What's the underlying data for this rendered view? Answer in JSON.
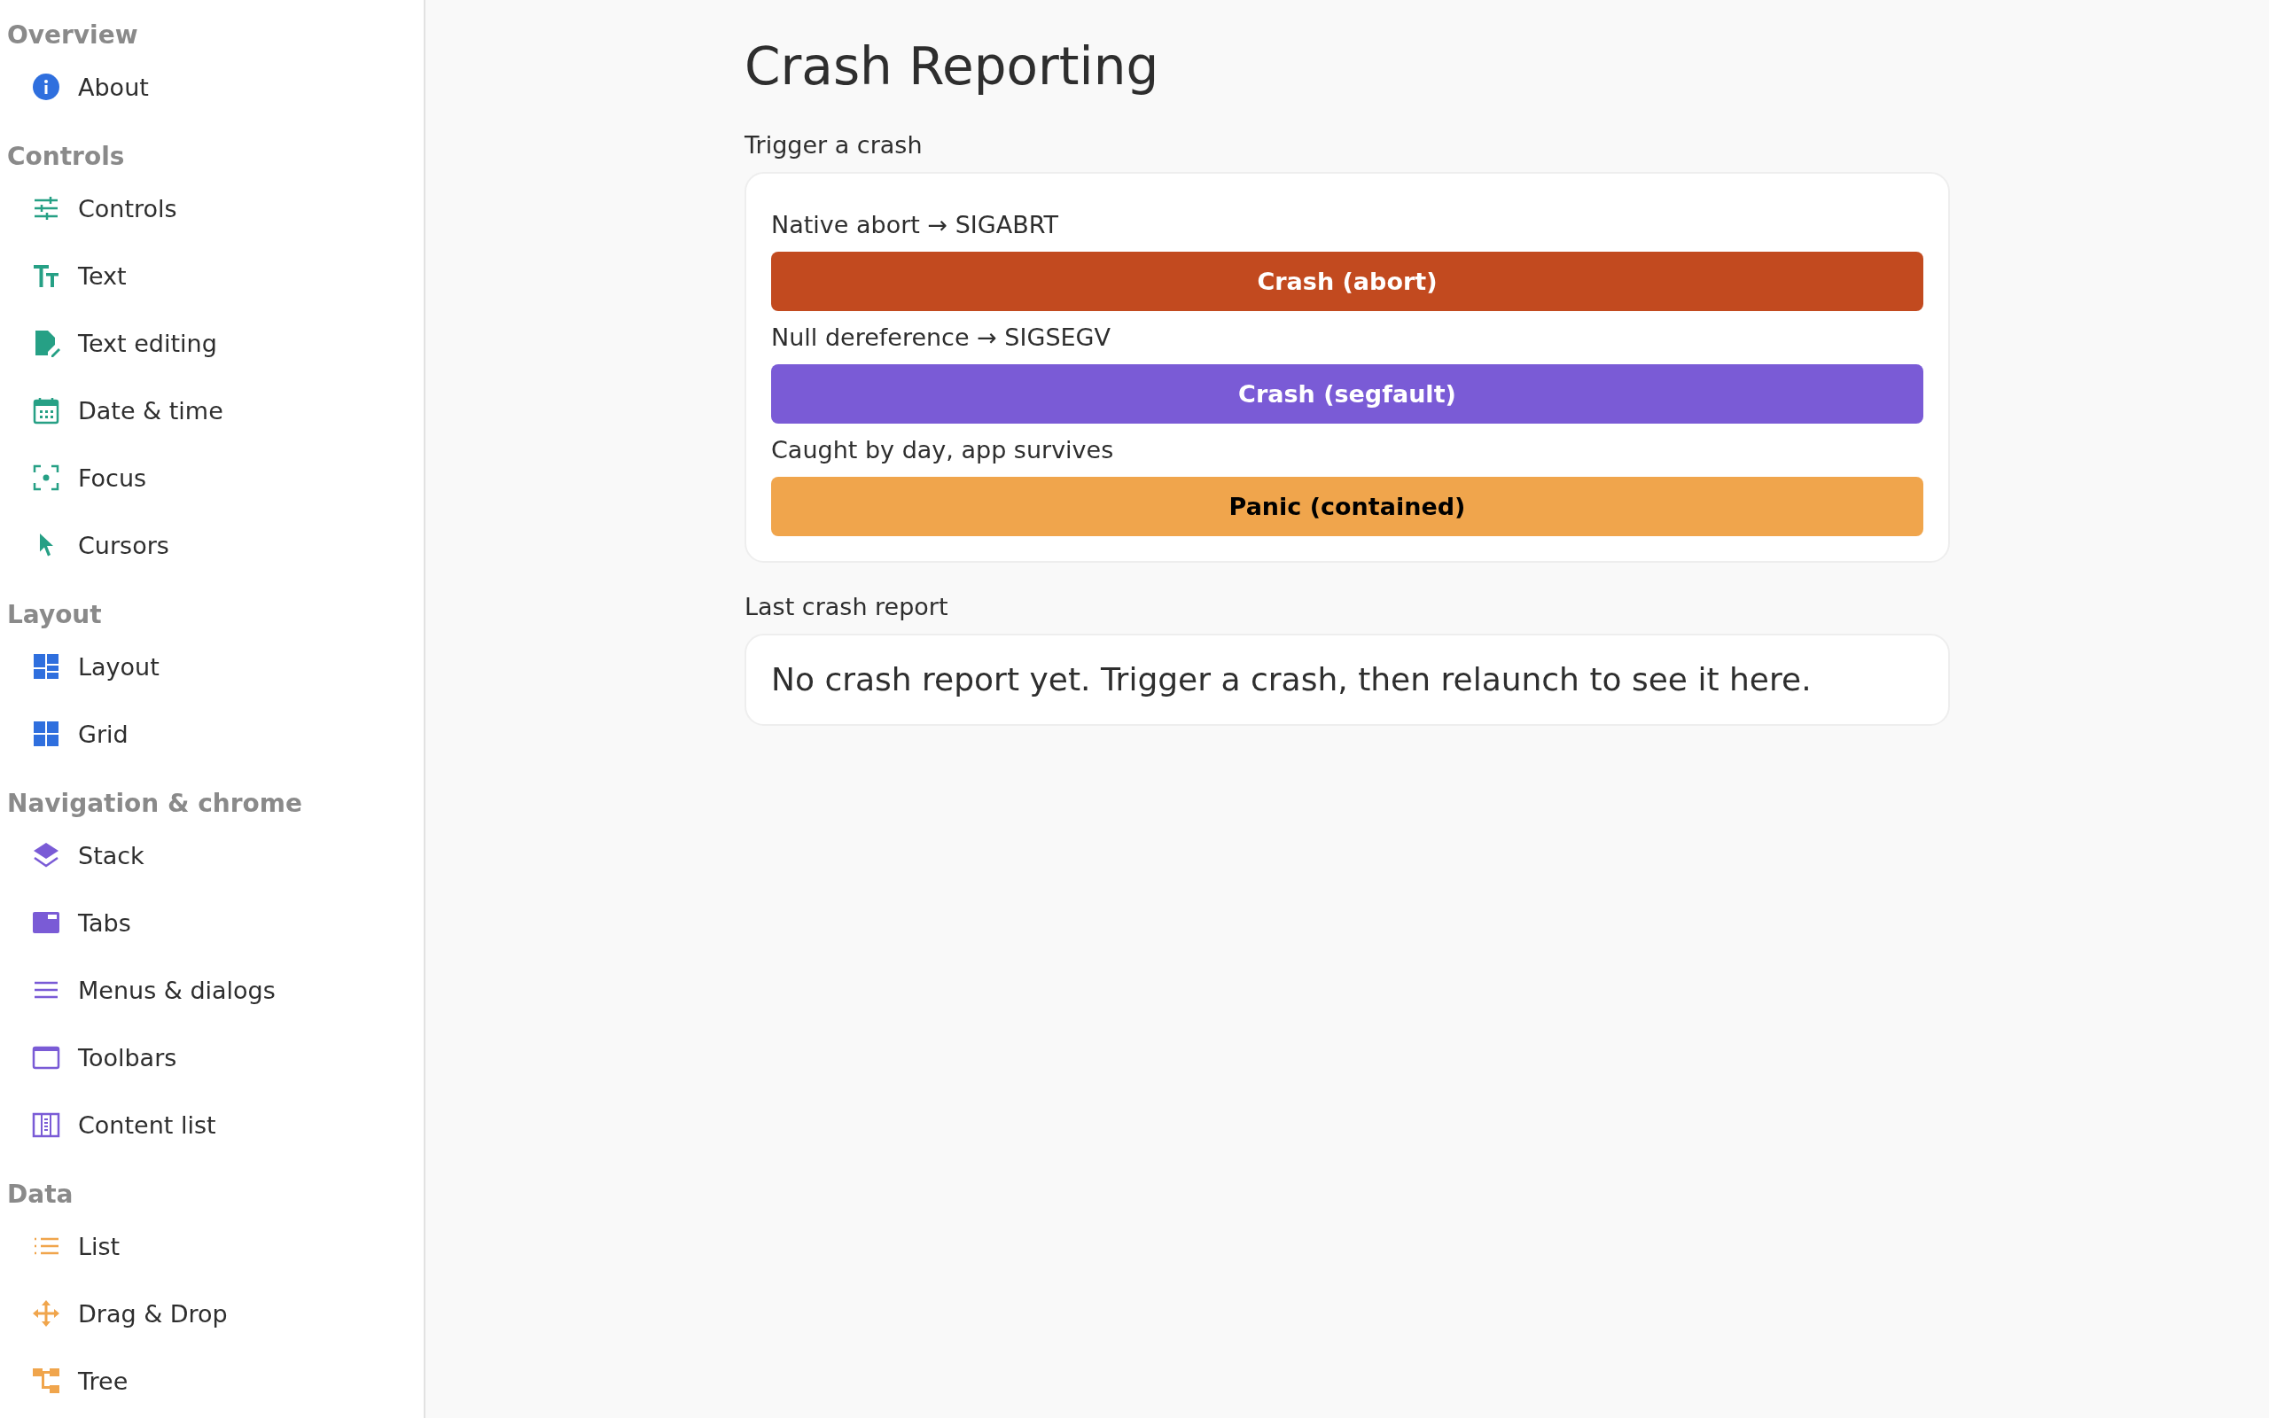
{
  "sidebar": {
    "sections": [
      {
        "title": "Overview",
        "color": "#2f6fde",
        "items": [
          {
            "label": "About"
          }
        ]
      },
      {
        "title": "Controls",
        "color": "#26a085",
        "items": [
          {
            "label": "Controls"
          },
          {
            "label": "Text"
          },
          {
            "label": "Text editing"
          },
          {
            "label": "Date & time"
          },
          {
            "label": "Focus"
          },
          {
            "label": "Cursors"
          }
        ]
      },
      {
        "title": "Layout",
        "color": "#2f6fde",
        "items": [
          {
            "label": "Layout"
          },
          {
            "label": "Grid"
          }
        ]
      },
      {
        "title": "Navigation & chrome",
        "color": "#7a5bd6",
        "items": [
          {
            "label": "Stack"
          },
          {
            "label": "Tabs"
          },
          {
            "label": "Menus & dialogs"
          },
          {
            "label": "Toolbars"
          },
          {
            "label": "Content list"
          }
        ]
      },
      {
        "title": "Data",
        "color": "#f0a54c",
        "items": [
          {
            "label": "List"
          },
          {
            "label": "Drag & Drop"
          },
          {
            "label": "Tree"
          }
        ]
      }
    ]
  },
  "page": {
    "title": "Crash Reporting",
    "trigger": {
      "heading": "Trigger a crash",
      "actions": [
        {
          "description": "Native abort → SIGABRT",
          "button": "Crash (abort)",
          "color": "#c24a1f"
        },
        {
          "description": "Null dereference → SIGSEGV",
          "button": "Crash (segfault)",
          "color": "#7a5bd6"
        },
        {
          "description": "Caught by day, app survives",
          "button": "Panic (contained)",
          "color": "#f0a54c"
        }
      ]
    },
    "report": {
      "heading": "Last crash report",
      "text": "No crash report yet. Trigger a crash, then relaunch to see it here."
    }
  }
}
